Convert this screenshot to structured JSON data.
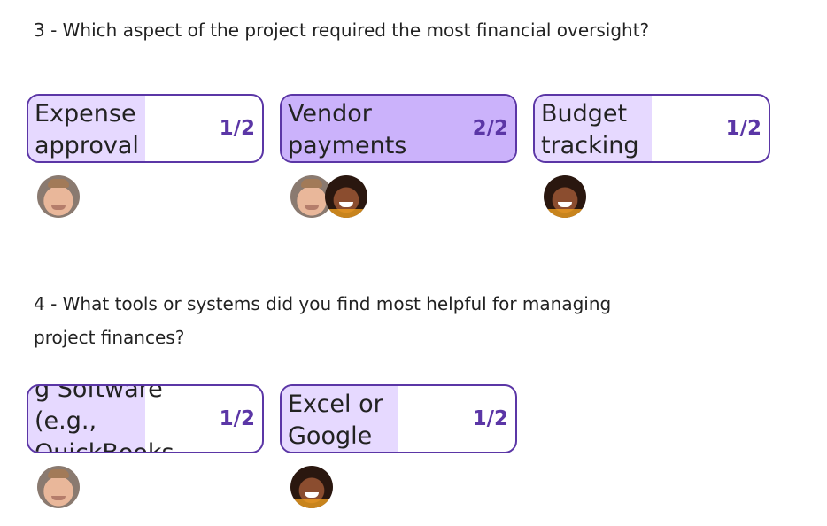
{
  "questions": [
    {
      "text": "3 - Which aspect of the project required the most financial oversight?",
      "options": [
        {
          "label": "Expense approval",
          "count": "1/2",
          "fraction": 0.5,
          "voters": [
            "man"
          ]
        },
        {
          "label": "Vendor payments",
          "count": "2/2",
          "fraction": 1.0,
          "voters": [
            "man",
            "woman"
          ]
        },
        {
          "label": "Budget tracking",
          "count": "1/2",
          "fraction": 0.5,
          "voters": [
            "woman"
          ]
        }
      ]
    },
    {
      "text": "4 - What tools or systems did you find most helpful for managing project finances?",
      "options": [
        {
          "label": "g Software (e.g., QuickBooks",
          "count": "1/2",
          "fraction": 0.5,
          "voters": [
            "man"
          ]
        },
        {
          "label": "Excel or Google Sheets",
          "count": "1/2",
          "fraction": 0.5,
          "voters": [
            "woman"
          ]
        }
      ]
    }
  ],
  "colors": {
    "accent": "#5b36a6",
    "fill_partial": "#e6d9ff",
    "fill_full": "#cbb2fb"
  },
  "icons": {
    "man": "avatar-man-icon",
    "woman": "avatar-woman-icon"
  }
}
